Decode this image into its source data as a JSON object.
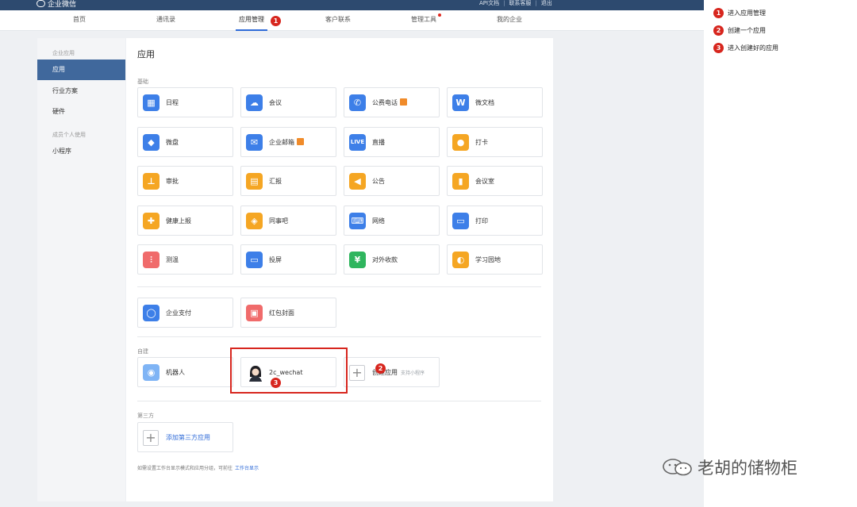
{
  "brand": {
    "name": "企业微信"
  },
  "top_links": [
    "API文档",
    "联系客服",
    "退出"
  ],
  "nav": {
    "items": [
      {
        "label": "首页"
      },
      {
        "label": "通讯录"
      },
      {
        "label": "应用管理",
        "active": true
      },
      {
        "label": "客户联系"
      },
      {
        "label": "管理工具",
        "dot": true
      },
      {
        "label": "我的企业"
      }
    ]
  },
  "sidebar": {
    "group1": "企业应用",
    "items1": [
      "应用",
      "行业方案",
      "硬件"
    ],
    "group2": "成员个人使用",
    "items2": [
      "小程序"
    ]
  },
  "main": {
    "title": "应用",
    "section_basic": "基础",
    "basic_apps": [
      {
        "label": "日程",
        "icon": "calendar-icon",
        "color": "#3d7fe8"
      },
      {
        "label": "会议",
        "icon": "cloud-icon",
        "color": "#3d7fe8"
      },
      {
        "label": "公费电话",
        "icon": "phone-icon",
        "color": "#3d7fe8",
        "badge": true
      },
      {
        "label": "微文档",
        "icon": "w-doc-icon",
        "color": "#3d7fe8"
      },
      {
        "label": "微盘",
        "icon": "drive-icon",
        "color": "#3d7fe8"
      },
      {
        "label": "企业邮箱",
        "icon": "mail-icon",
        "color": "#3d7fe8",
        "badge": true
      },
      {
        "label": "直播",
        "icon": "live-icon",
        "color": "#3d7fe8"
      },
      {
        "label": "打卡",
        "icon": "location-icon",
        "color": "#f5a623"
      },
      {
        "label": "审批",
        "icon": "stamp-icon",
        "color": "#f5a623"
      },
      {
        "label": "汇报",
        "icon": "report-icon",
        "color": "#f5a623"
      },
      {
        "label": "公告",
        "icon": "megaphone-icon",
        "color": "#f5a623"
      },
      {
        "label": "会议室",
        "icon": "door-icon",
        "color": "#f5a623"
      },
      {
        "label": "健康上报",
        "icon": "health-icon",
        "color": "#f5a623"
      },
      {
        "label": "同事吧",
        "icon": "colleague-icon",
        "color": "#f5a623"
      },
      {
        "label": "网络",
        "icon": "network-icon",
        "color": "#3d7fe8"
      },
      {
        "label": "打印",
        "icon": "printer-icon",
        "color": "#3d7fe8"
      },
      {
        "label": "测温",
        "icon": "thermometer-icon",
        "color": "#f06b6b"
      },
      {
        "label": "投屏",
        "icon": "screen-cast-icon",
        "color": "#3d7fe8"
      },
      {
        "label": "对外收款",
        "icon": "payment-icon",
        "color": "#2fb55e"
      },
      {
        "label": "学习园地",
        "icon": "planet-icon",
        "color": "#f5a623"
      }
    ],
    "extra_apps": [
      {
        "label": "企业支付",
        "icon": "pay-icon",
        "color": "#3d7fe8"
      },
      {
        "label": "红包封面",
        "icon": "red-packet-icon",
        "color": "#f06b6b"
      }
    ],
    "section_custom": "自建",
    "custom_apps": [
      {
        "label": "机器人",
        "icon": "robot-icon",
        "color": "#7fb4f5"
      },
      {
        "label": "2c_wechat",
        "icon": "avatar-icon"
      }
    ],
    "create_app": {
      "label": "创建应用",
      "sub": "支持小程序"
    },
    "section_third": "第三方",
    "add_third": {
      "label": "添加第三方应用"
    },
    "hint_text": "如需设置工作台显示模式和应用分组，可前往",
    "hint_link": "工作台显示"
  },
  "markers": [
    "1",
    "2",
    "3"
  ],
  "legend": [
    {
      "num": "1",
      "text": "进入应用管理"
    },
    {
      "num": "2",
      "text": "创建一个应用"
    },
    {
      "num": "3",
      "text": "进入创建好的应用"
    }
  ],
  "watermark": "老胡的储物柜",
  "colors": {
    "topbar": "#2d4a6f",
    "accent": "#2f6bd8",
    "sidebar_active": "#40689c",
    "marker_red": "#d7261e"
  }
}
